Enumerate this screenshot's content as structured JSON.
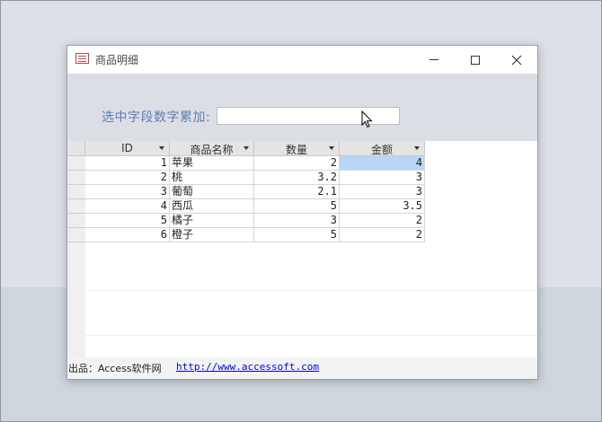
{
  "window": {
    "title": "商品明细",
    "controls": [
      "minimize",
      "maximize",
      "close"
    ]
  },
  "form": {
    "sum_label": "选中字段数字累加:",
    "sum_value": ""
  },
  "datasheet": {
    "columns": [
      "ID",
      "商品名称",
      "数量",
      "金额"
    ],
    "rows": [
      {
        "id": "1",
        "name": "苹果",
        "qty": "2",
        "amount": "4"
      },
      {
        "id": "2",
        "name": "桃",
        "qty": "3.2",
        "amount": "3"
      },
      {
        "id": "3",
        "name": "葡萄",
        "qty": "2.1",
        "amount": "3"
      },
      {
        "id": "4",
        "name": "西瓜",
        "qty": "5",
        "amount": "3.5"
      },
      {
        "id": "5",
        "name": "橘子",
        "qty": "3",
        "amount": "2"
      },
      {
        "id": "6",
        "name": "橙子",
        "qty": "5",
        "amount": "2"
      }
    ],
    "selected_cell": {
      "row": 1,
      "column": "金额"
    },
    "selection_color": "#b8d6f7"
  },
  "footer": {
    "label": "出品：Access软件网",
    "link": "http://www.accessoft.com"
  },
  "colors": {
    "label_blue": "#5d7fb0",
    "header_bg": "#dcdee5",
    "link": "#0000ee"
  }
}
